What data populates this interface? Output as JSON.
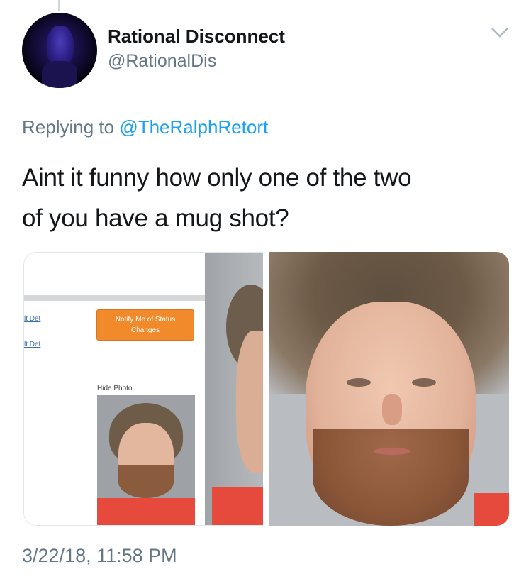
{
  "tweet": {
    "author_name": "Rational Disconnect",
    "author_handle": "@RationalDis",
    "replying_prefix": "Replying to",
    "replying_mention": "@TheRalphRetort",
    "text_line1": "Aint it funny how only one of the two",
    "text_line2": "of you have a mug shot?",
    "timestamp": "3/22/18, 11:58 PM"
  },
  "media": {
    "left_panel": {
      "link1": "lt Det",
      "link2": "lt Det",
      "notify_button_line1": "Notify Me of Status",
      "notify_button_line2": "Changes",
      "hide_photo": "Hide Photo"
    }
  },
  "icons": {
    "menu": "chevron-down-icon"
  },
  "colors": {
    "link": "#1da1f2",
    "secondary_text": "#657786",
    "primary_text": "#14171a",
    "notify_button": "#f08a2b"
  }
}
